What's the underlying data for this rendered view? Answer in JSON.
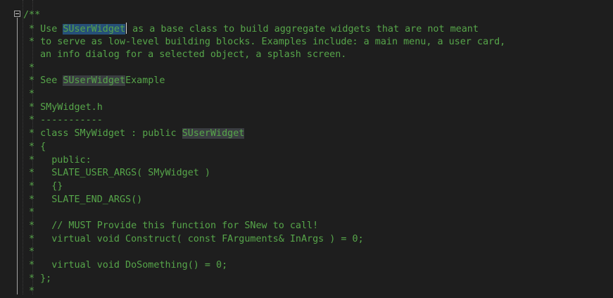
{
  "editor": {
    "comment_color": "#57a64a",
    "background": "#1e1e1e",
    "fold": "collapse-minus-icon",
    "lines": [
      {
        "text": "/**"
      },
      {
        "pre": "* Use ",
        "hl": "SUserWidget",
        "post": " as a base class to build aggregate widgets that are not meant"
      },
      {
        "text": "* to serve as low-level building blocks. Examples include: a main menu, a user card,"
      },
      {
        "text": "an info dialog for a selected object, a splash screen."
      },
      {
        "text": "*"
      },
      {
        "pre": "* See ",
        "hl": "SUserWidget",
        "post": "Example"
      },
      {
        "text": "*"
      },
      {
        "text": "* SMyWidget.h"
      },
      {
        "text": "* -----------"
      },
      {
        "pre": "* class SMyWidget : public ",
        "hl": "SUserWidget",
        "post": ""
      },
      {
        "text": "* {"
      },
      {
        "text": "*   public:"
      },
      {
        "text": "*   SLATE_USER_ARGS( SMyWidget )"
      },
      {
        "text": "*   {}"
      },
      {
        "text": "*   SLATE_END_ARGS()"
      },
      {
        "text": "*"
      },
      {
        "text": "*   // MUST Provide this function for SNew to call!"
      },
      {
        "text": "*   virtual void Construct( const FArguments& InArgs ) = 0;"
      },
      {
        "text": "*"
      },
      {
        "text": "*   virtual void DoSomething() = 0;"
      },
      {
        "text": "* };"
      },
      {
        "text": "*"
      }
    ]
  }
}
